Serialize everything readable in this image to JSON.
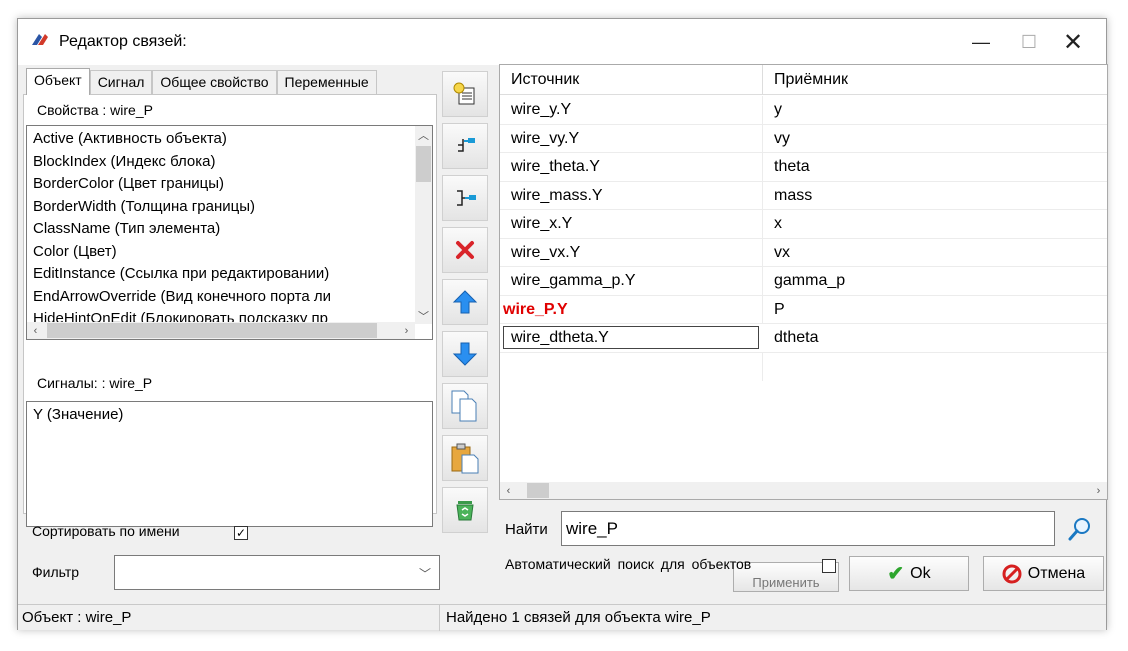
{
  "window": {
    "title": "Редактор связей:"
  },
  "tabs": [
    "Объект",
    "Сигнал",
    "Общее свойство",
    "Переменные"
  ],
  "properties": {
    "label": "Свойства : wire_P",
    "items": [
      "Active  (Активность объекта)",
      "BlockIndex  (Индекс блока)",
      "BorderColor  (Цвет границы)",
      "BorderWidth  (Толщина границы)",
      "ClassName  (Тип элемента)",
      "Color  (Цвет)",
      "EditInstance  (Ссылка при редактировании)",
      "EndArrowOverride  (Вид конечного порта ли",
      "HideHintOnEdit  (Блокировать подсказку пр"
    ]
  },
  "signals": {
    "label": "Сигналы: : wire_P",
    "items": [
      "Y  (Значение)"
    ]
  },
  "sort": {
    "label": "Сортировать по имени",
    "checked": true
  },
  "filter": {
    "label": "Фильтр",
    "value": ""
  },
  "grid": {
    "columns": [
      "Источник",
      "Приёмник"
    ],
    "rows": [
      {
        "source": "wire_y.Y",
        "target": "y"
      },
      {
        "source": "wire_vy.Y",
        "target": "vy"
      },
      {
        "source": "wire_theta.Y",
        "target": "theta"
      },
      {
        "source": "wire_mass.Y",
        "target": "mass"
      },
      {
        "source": "wire_x.Y",
        "target": "x"
      },
      {
        "source": "wire_vx.Y",
        "target": "vx"
      },
      {
        "source": "wire_gamma_p.Y",
        "target": "gamma_p"
      },
      {
        "source": "wire_P.Y",
        "target": "P"
      },
      {
        "source": "wire_dtheta.Y",
        "target": "dtheta"
      }
    ]
  },
  "find": {
    "label": "Найти",
    "value": "wire_P"
  },
  "auto_search": {
    "label": "Автоматический поиск для объектов",
    "checked": false
  },
  "buttons": {
    "apply": "Применить",
    "ok": "Ok",
    "cancel": "Отмена"
  },
  "status": {
    "left": "Объект : wire_P",
    "right": "Найдено  1  связей для объекта wire_P"
  },
  "colors": {
    "highlight": "#e00000",
    "accent_blue": "#1e90ff"
  }
}
